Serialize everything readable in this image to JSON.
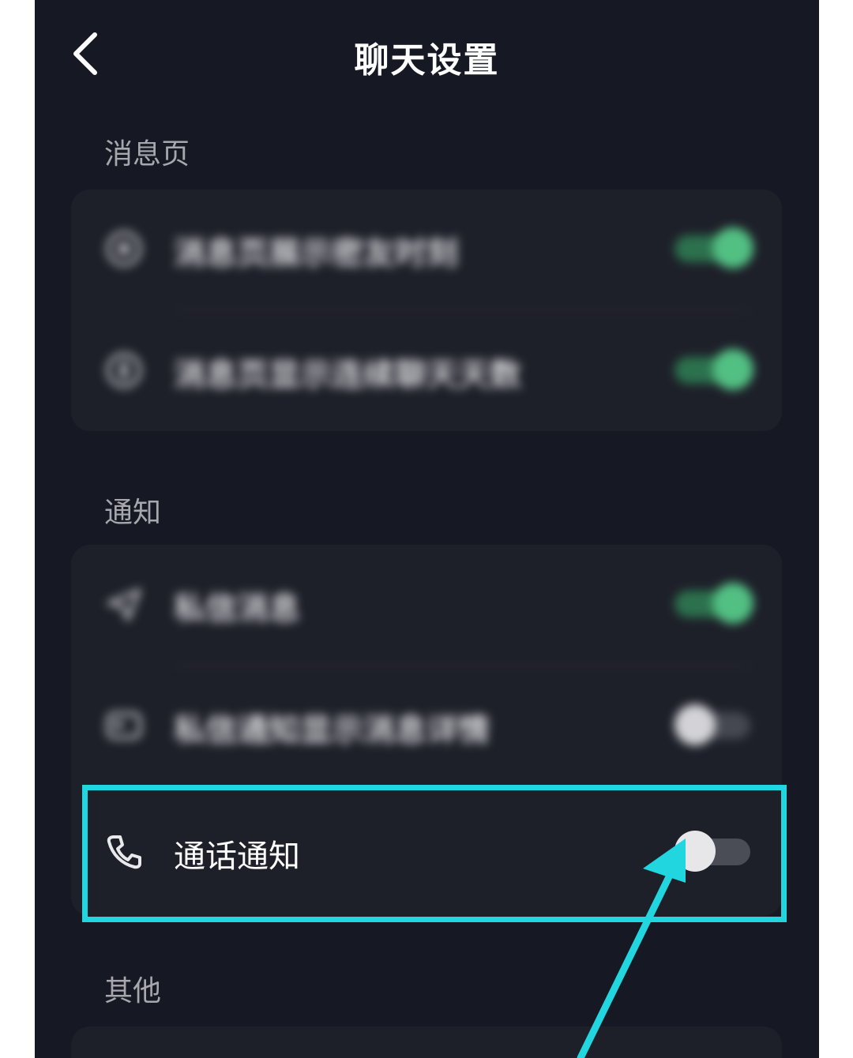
{
  "header": {
    "title": "聊天设置",
    "back_icon": "chevron-left-icon"
  },
  "sections": [
    {
      "label": "消息页",
      "rows": [
        {
          "label": "消息页展示密友时刻",
          "icon": "moment-icon",
          "toggle": "on"
        },
        {
          "label": "消息页显示连续聊天天数",
          "icon": "flame-icon",
          "toggle": "on"
        }
      ]
    },
    {
      "label": "通知",
      "rows": [
        {
          "label": "私信消息",
          "icon": "send-icon",
          "toggle": "on"
        },
        {
          "label": "私信通知显示消息详情",
          "icon": "message-card-icon",
          "toggle": "off"
        },
        {
          "label": "通话通知",
          "icon": "phone-icon",
          "toggle": "off"
        }
      ]
    },
    {
      "label": "其他",
      "rows": []
    }
  ],
  "colors": {
    "background": "#161823",
    "card": "#1e2029",
    "toggle_on": "#58d18d",
    "highlight": "#22d6e0"
  }
}
